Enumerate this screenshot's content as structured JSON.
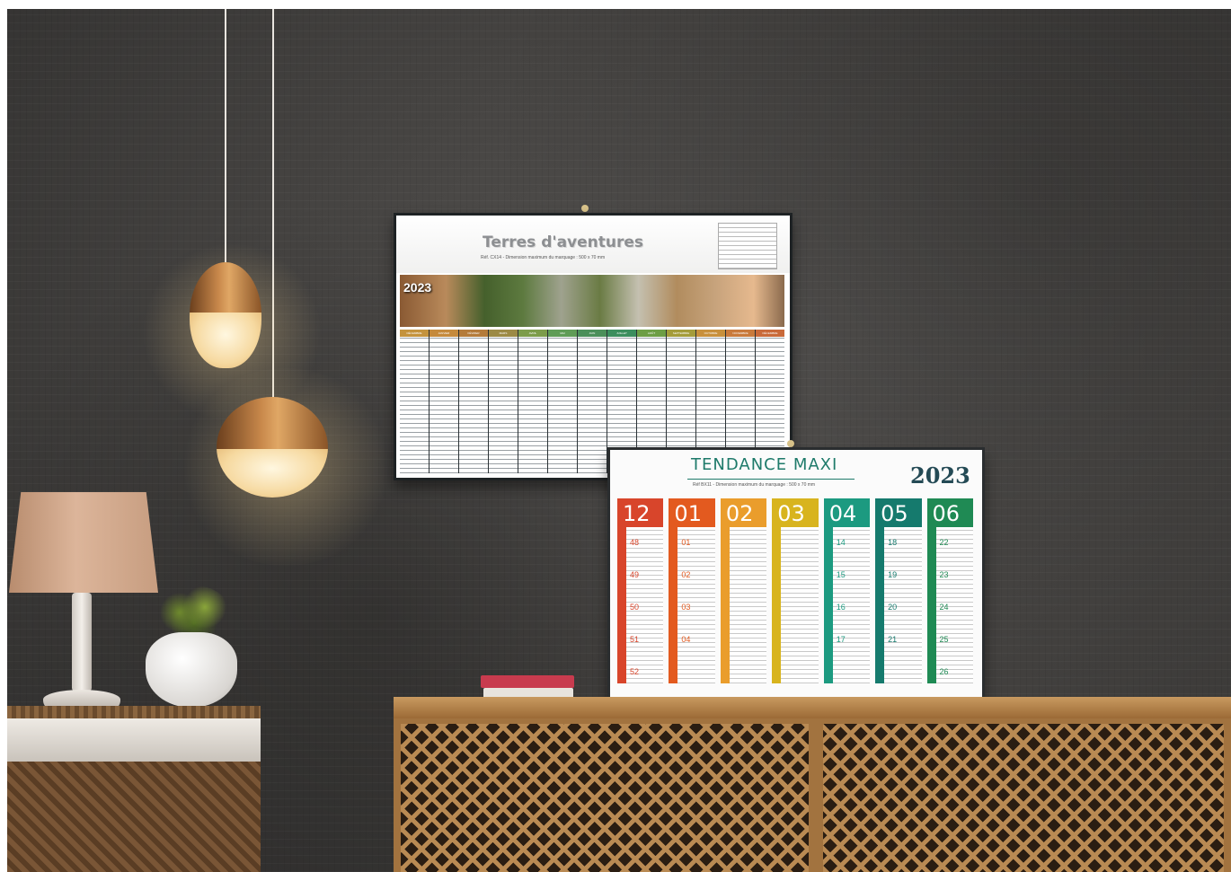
{
  "calendar_one": {
    "title": "Terres d'aventures",
    "reference": "Réf. CX14 - Dimension maximum du marquage : 500 x 70 mm",
    "year": "2023",
    "months": [
      "DÉCEMBRE",
      "JANVIER",
      "FÉVRIER",
      "MARS",
      "AVRIL",
      "MAI",
      "JUIN",
      "JUILLET",
      "AOÛT",
      "SEPTEMBRE",
      "OCTOBRE",
      "NOVEMBRE",
      "DÉCEMBRE"
    ]
  },
  "calendar_two": {
    "title": "TENDANCE MAXI",
    "reference": "Réf BX11 - Dimension maximum du marquage : 500 x 70 mm",
    "year": "2023",
    "months": [
      {
        "number": "12",
        "weeks": [
          "48",
          "49",
          "50",
          "51",
          "52"
        ]
      },
      {
        "number": "01",
        "weeks": [
          "01",
          "02",
          "03",
          "04"
        ]
      },
      {
        "number": "02",
        "weeks": [
          "",
          "",
          "",
          ""
        ]
      },
      {
        "number": "03",
        "weeks": [
          "",
          "",
          "",
          ""
        ]
      },
      {
        "number": "04",
        "weeks": [
          "14",
          "15",
          "16",
          "17"
        ]
      },
      {
        "number": "05",
        "weeks": [
          "18",
          "19",
          "20",
          "21"
        ]
      },
      {
        "number": "06",
        "weeks": [
          "22",
          "23",
          "24",
          "25",
          "26"
        ]
      }
    ]
  },
  "colors": {
    "month_palette": [
      "#d8452b",
      "#e35a1f",
      "#ea9d2c",
      "#d8b41e",
      "#1c9a80",
      "#157a6d",
      "#1f8a54"
    ],
    "calendar_one_heads": [
      "#c4933d",
      "#c58a3c",
      "#b47b3a",
      "#9c8a45",
      "#7c9c4a",
      "#5f9c56",
      "#4b8f5a",
      "#3c8e5e",
      "#6d9e45",
      "#a49c3a",
      "#c8903c",
      "#c97a3c",
      "#c96a3a"
    ]
  }
}
